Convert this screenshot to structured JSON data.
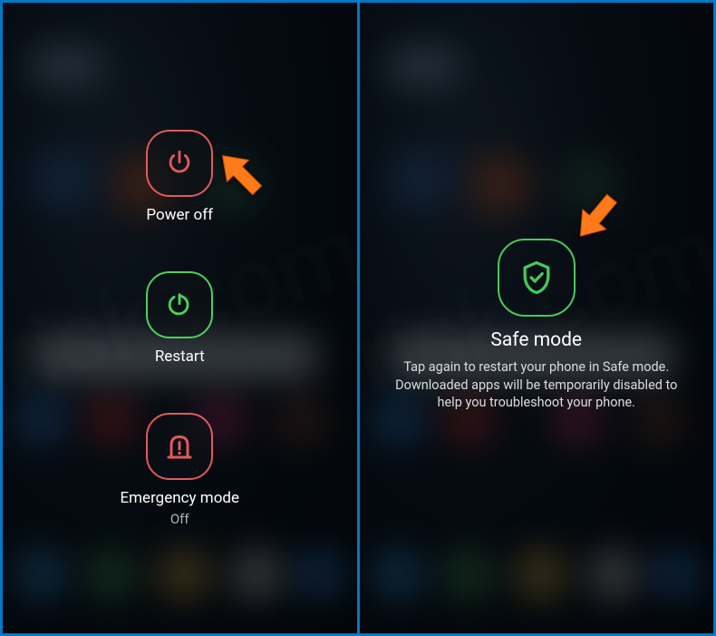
{
  "left": {
    "power_off": {
      "label": "Power off"
    },
    "restart": {
      "label": "Restart"
    },
    "emergency": {
      "label": "Emergency mode",
      "status": "Off"
    }
  },
  "right": {
    "safe_mode": {
      "title": "Safe mode",
      "description": "Tap again to restart your phone in Safe mode. Downloaded apps will be temporarily disabled to help you troubleshoot your phone."
    }
  },
  "colors": {
    "border": "#0078c8",
    "red": "#e05a5a",
    "green": "#4fcf5a",
    "arrow": "#ff7a1a"
  },
  "watermark": "risk.com"
}
